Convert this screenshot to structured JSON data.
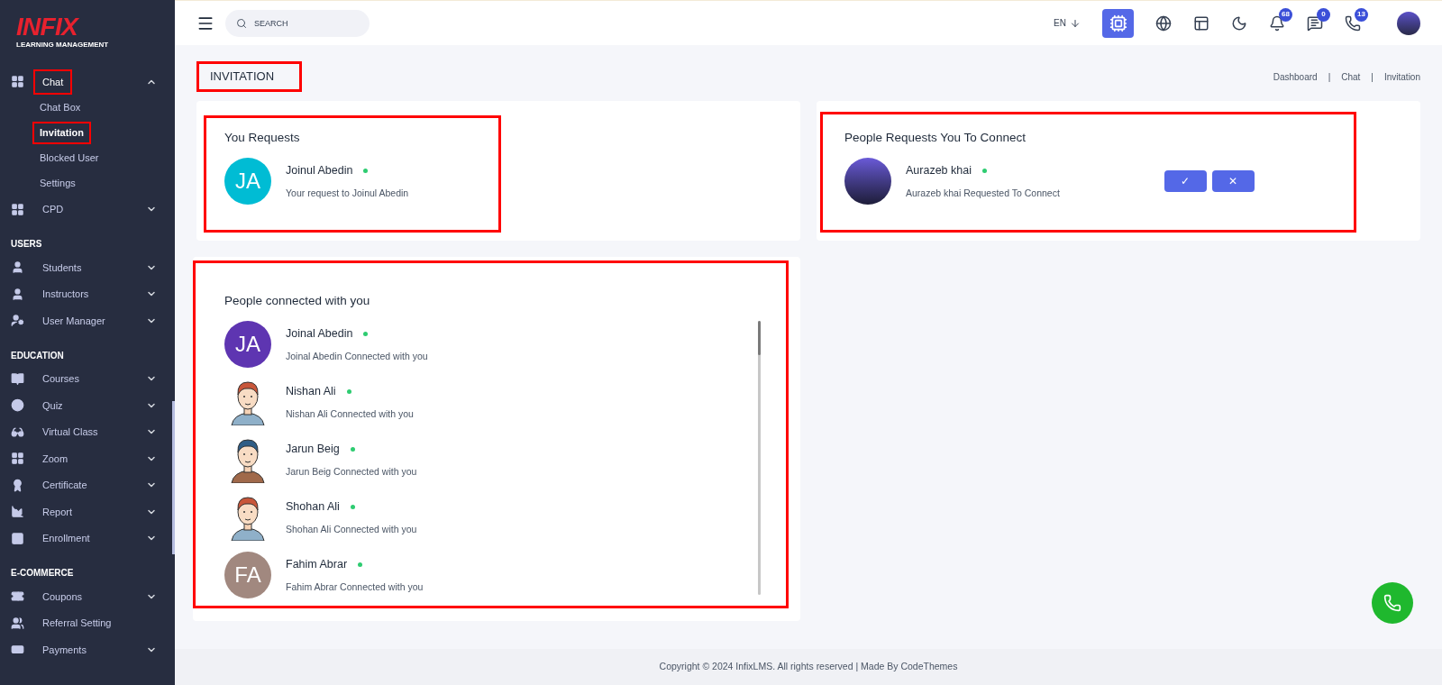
{
  "sidebar": {
    "logo": {
      "title": "INFIX",
      "subtitle": "LEARNING MANAGEMENT"
    },
    "sections": [
      {
        "items": [
          {
            "label": "Chat",
            "expanded": true,
            "highlighted": true,
            "children": [
              {
                "label": "Chat Box",
                "selected": false,
                "highlighted": false
              },
              {
                "label": "Invitation",
                "selected": true,
                "highlighted": true
              },
              {
                "label": "Blocked User",
                "selected": false,
                "highlighted": false
              },
              {
                "label": "Settings",
                "selected": false,
                "highlighted": false
              }
            ]
          },
          {
            "label": "CPD",
            "expanded": false,
            "highlighted": false
          }
        ]
      },
      {
        "title": "USERS",
        "items": [
          {
            "label": "Students",
            "expanded": false,
            "highlighted": false
          },
          {
            "label": "Instructors",
            "expanded": false,
            "highlighted": false
          },
          {
            "label": "User Manager",
            "expanded": false,
            "highlighted": false
          }
        ]
      },
      {
        "title": "EDUCATION",
        "items": [
          {
            "label": "Courses",
            "expanded": false,
            "highlighted": false
          },
          {
            "label": "Quiz",
            "expanded": false,
            "highlighted": false
          },
          {
            "label": "Virtual Class",
            "expanded": false,
            "highlighted": false
          },
          {
            "label": "Zoom",
            "expanded": false,
            "highlighted": false
          },
          {
            "label": "Certificate",
            "expanded": false,
            "highlighted": false
          },
          {
            "label": "Report",
            "expanded": false,
            "highlighted": false
          },
          {
            "label": "Enrollment",
            "expanded": false,
            "highlighted": false
          }
        ]
      },
      {
        "title": "E-COMMERCE",
        "items": [
          {
            "label": "Coupons",
            "expanded": false,
            "highlighted": false
          },
          {
            "label": "Referral Setting",
            "highlighted": false
          },
          {
            "label": "Payments",
            "expanded": false,
            "highlighted": false
          }
        ]
      }
    ]
  },
  "topbar": {
    "search": {
      "placeholder": "SEARCH"
    },
    "language": "EN",
    "badges": {
      "notifications": "68",
      "messages": "0",
      "whatsapp": "13"
    }
  },
  "page": {
    "title": "INVITATION",
    "title_highlighted": true,
    "breadcrumb": [
      "Dashboard",
      "Chat",
      "Invitation"
    ],
    "breadcrumb_separator": "|"
  },
  "you_requests": {
    "title": "You Requests",
    "highlighted": true,
    "items": [
      {
        "name": "Joinul Abedin",
        "online": true,
        "message": "Your request to Joinul Abedin",
        "avatar": {
          "kind": "initials",
          "text": "JA",
          "color": "#00bcd4"
        }
      }
    ]
  },
  "incoming_requests": {
    "title": "People Requests You To Connect",
    "highlighted": true,
    "items": [
      {
        "name": "Aurazeb khai",
        "online": true,
        "message": "Aurazeb khai Requested To Connect",
        "avatar": {
          "kind": "photo"
        },
        "accept": "✓",
        "decline": "✕"
      }
    ]
  },
  "connected": {
    "title": "People connected with you",
    "highlighted": true,
    "items": [
      {
        "name": "Joinal Abedin",
        "online": true,
        "message": "Joinal Abedin Connected with you",
        "avatar": {
          "kind": "initials",
          "text": "JA",
          "color": "#5e35b1"
        }
      },
      {
        "name": "Nishan Ali",
        "online": true,
        "message": "Nishan Ali Connected with you",
        "avatar": {
          "kind": "cartoon"
        }
      },
      {
        "name": "Jarun Beig",
        "online": true,
        "message": "Jarun Beig Connected with you",
        "avatar": {
          "kind": "cartoon"
        }
      },
      {
        "name": "Shohan Ali",
        "online": true,
        "message": "Shohan Ali Connected with you",
        "avatar": {
          "kind": "cartoon"
        }
      },
      {
        "name": "Fahim Abrar",
        "online": true,
        "message": "Fahim Abrar Connected with you",
        "avatar": {
          "kind": "initials",
          "text": "FA",
          "color": "#a1887f"
        }
      }
    ]
  },
  "footer": "Copyright © 2024 InfixLMS. All rights reserved | Made By CodeThemes"
}
